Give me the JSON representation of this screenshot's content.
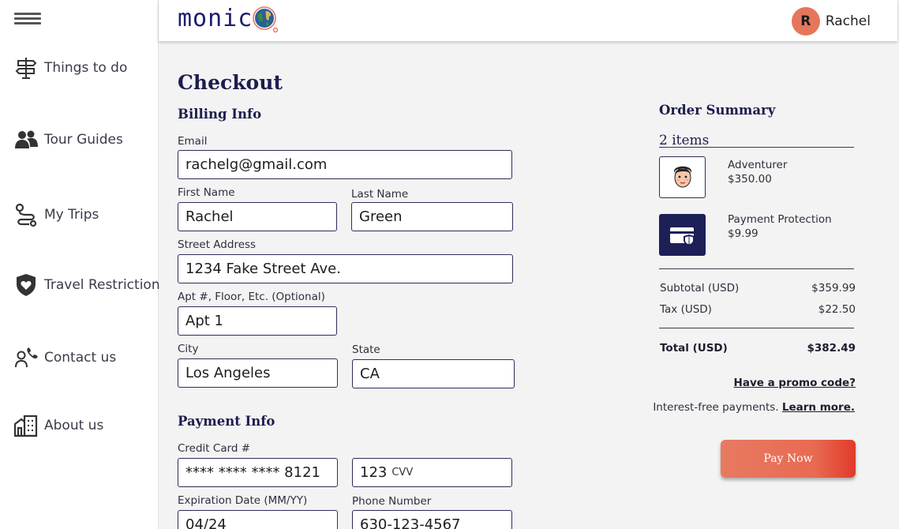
{
  "header": {
    "logo_text": "monic",
    "user_initial": "R",
    "user_name": "Rachel"
  },
  "sidebar": {
    "items": [
      {
        "label": "Things to do",
        "icon": "signpost-icon"
      },
      {
        "label": "Tour Guides",
        "icon": "people-icon"
      },
      {
        "label": "My Trips",
        "icon": "route-icon"
      },
      {
        "label": "Travel Restriction",
        "icon": "shield-heart-icon"
      },
      {
        "label": "Contact us",
        "icon": "contact-phone-icon"
      },
      {
        "label": "About us",
        "icon": "building-icon"
      }
    ]
  },
  "checkout": {
    "title": "Checkout",
    "billing_title": "Billing Info",
    "email_label": "Email",
    "email_value": "rachelg@gmail.com",
    "first_name_label": "First Name",
    "first_name_value": "Rachel",
    "last_name_label": "Last Name",
    "last_name_value": "Green",
    "street_label": "Street Address",
    "street_value": "1234 Fake Street Ave.",
    "apt_label": "Apt #, Floor, Etc. (Optional)",
    "apt_value": "Apt 1",
    "city_label": "City",
    "city_value": "Los Angeles",
    "state_label": "State",
    "state_value": "CA",
    "payment_title": "Payment Info",
    "card_label": "Credit Card #",
    "card_value": "**** **** **** 8121",
    "cvv_value": "123",
    "cvv_suffix": "CVV",
    "exp_label": "Expiration Date (MM/YY)",
    "exp_value": "04/24",
    "phone_label": "Phone Number",
    "phone_value": "630-123-4567"
  },
  "summary": {
    "title": "Order Summary",
    "items_count": "2 items",
    "items": [
      {
        "name": "Adventurer",
        "price": "$350.00",
        "icon": "guide-face-icon"
      },
      {
        "name": "Payment Protection",
        "price": "$9.99",
        "icon": "card-shield-icon"
      }
    ],
    "subtotal_label": "Subtotal (USD)",
    "subtotal_value": "$359.99",
    "tax_label": "Tax (USD)",
    "tax_value": "$22.50",
    "total_label": "Total (USD)",
    "total_value": "$382.49",
    "promo_link": "Have a promo code?",
    "installments_text": "Interest-free payments.",
    "learn_more": "Learn more.",
    "pay_button": "Pay Now"
  },
  "colors": {
    "accent": "#e5765b",
    "navy": "#1d1f57"
  }
}
